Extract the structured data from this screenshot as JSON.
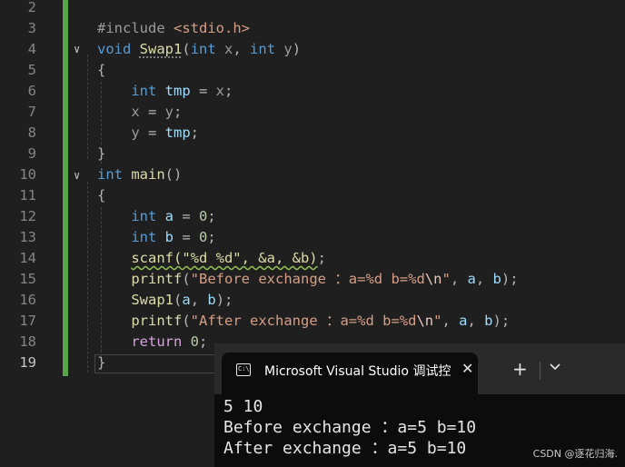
{
  "editor": {
    "line_numbers": [
      "2",
      "3",
      "4",
      "5",
      "6",
      "7",
      "8",
      "9",
      "10",
      "11",
      "12",
      "13",
      "14",
      "15",
      "16",
      "17",
      "18",
      "19"
    ],
    "active_line": "19",
    "lines": [
      [],
      [
        {
          "t": "#include ",
          "c": "pr"
        },
        {
          "t": "<stdio.h>",
          "c": "str"
        }
      ],
      [
        {
          "t": "void",
          "c": "kw"
        },
        {
          "t": " "
        },
        {
          "t": "Swap1",
          "c": "fn dots"
        },
        {
          "t": "(",
          "c": "pun"
        },
        {
          "t": "int",
          "c": "ty"
        },
        {
          "t": " x",
          "c": "pr"
        },
        {
          "t": ", ",
          "c": "pun"
        },
        {
          "t": "int",
          "c": "ty"
        },
        {
          "t": " y",
          "c": "pr"
        },
        {
          "t": ")",
          "c": "pun"
        }
      ],
      [
        {
          "t": "{",
          "c": "pun"
        }
      ],
      [
        {
          "t": "    "
        },
        {
          "t": "int",
          "c": "ty"
        },
        {
          "t": " "
        },
        {
          "t": "tmp",
          "c": "id"
        },
        {
          "t": " = ",
          "c": "pun"
        },
        {
          "t": "x",
          "c": "pr"
        },
        {
          "t": ";",
          "c": "pun"
        }
      ],
      [
        {
          "t": "    "
        },
        {
          "t": "x",
          "c": "pr"
        },
        {
          "t": " = ",
          "c": "pun"
        },
        {
          "t": "y",
          "c": "pr"
        },
        {
          "t": ";",
          "c": "pun"
        }
      ],
      [
        {
          "t": "    "
        },
        {
          "t": "y",
          "c": "pr"
        },
        {
          "t": " = ",
          "c": "pun"
        },
        {
          "t": "tmp",
          "c": "id"
        },
        {
          "t": ";",
          "c": "pun"
        }
      ],
      [
        {
          "t": "}",
          "c": "pun"
        }
      ],
      [
        {
          "t": "int",
          "c": "kw"
        },
        {
          "t": " "
        },
        {
          "t": "main",
          "c": "fn"
        },
        {
          "t": "()",
          "c": "pun"
        }
      ],
      [
        {
          "t": "{",
          "c": "pun"
        }
      ],
      [
        {
          "t": "    "
        },
        {
          "t": "int",
          "c": "ty"
        },
        {
          "t": " "
        },
        {
          "t": "a",
          "c": "id"
        },
        {
          "t": " = ",
          "c": "pun"
        },
        {
          "t": "0",
          "c": "num"
        },
        {
          "t": ";",
          "c": "pun"
        }
      ],
      [
        {
          "t": "    "
        },
        {
          "t": "int",
          "c": "ty"
        },
        {
          "t": " "
        },
        {
          "t": "b",
          "c": "id"
        },
        {
          "t": " = ",
          "c": "pun"
        },
        {
          "t": "0",
          "c": "num"
        },
        {
          "t": ";",
          "c": "pun"
        }
      ],
      [
        {
          "t": "    "
        },
        {
          "t": "scanf(\"%d %d\", &a, &b)",
          "c": "fn squig"
        },
        {
          "t": ";",
          "c": "pun"
        }
      ],
      [
        {
          "t": "    "
        },
        {
          "t": "printf",
          "c": "fn"
        },
        {
          "t": "(",
          "c": "pun"
        },
        {
          "t": "\"Before exchange ：a=%d b=%d",
          "c": "str"
        },
        {
          "t": "\\n",
          "c": "esc"
        },
        {
          "t": "\"",
          "c": "str"
        },
        {
          "t": ", ",
          "c": "pun"
        },
        {
          "t": "a",
          "c": "id"
        },
        {
          "t": ", ",
          "c": "pun"
        },
        {
          "t": "b",
          "c": "id"
        },
        {
          "t": ");",
          "c": "pun"
        }
      ],
      [
        {
          "t": "    "
        },
        {
          "t": "Swap1",
          "c": "fn"
        },
        {
          "t": "(",
          "c": "pun"
        },
        {
          "t": "a",
          "c": "id"
        },
        {
          "t": ", ",
          "c": "pun"
        },
        {
          "t": "b",
          "c": "id"
        },
        {
          "t": ");",
          "c": "pun"
        }
      ],
      [
        {
          "t": "    "
        },
        {
          "t": "printf",
          "c": "fn"
        },
        {
          "t": "(",
          "c": "pun"
        },
        {
          "t": "\"After exchange ：a=%d b=%d",
          "c": "str"
        },
        {
          "t": "\\n",
          "c": "esc"
        },
        {
          "t": "\"",
          "c": "str"
        },
        {
          "t": ", ",
          "c": "pun"
        },
        {
          "t": "a",
          "c": "id"
        },
        {
          "t": ", ",
          "c": "pun"
        },
        {
          "t": "b",
          "c": "id"
        },
        {
          "t": ");",
          "c": "pun"
        }
      ],
      [
        {
          "t": "    "
        },
        {
          "t": "return",
          "c": "ctl"
        },
        {
          "t": " "
        },
        {
          "t": "0",
          "c": "num"
        },
        {
          "t": ";",
          "c": "pun"
        }
      ],
      [
        {
          "t": "}",
          "c": "pun"
        }
      ]
    ]
  },
  "terminal": {
    "tab_title": "Microsoft Visual Studio 调试控",
    "icon_glyph": "C:\\",
    "close_glyph": "✕",
    "add_glyph": "+",
    "output": [
      "5 10",
      "Before exchange ：a=5 b=10",
      "After exchange ：a=5 b=10"
    ]
  },
  "watermark": "CSDN @逐花归海."
}
